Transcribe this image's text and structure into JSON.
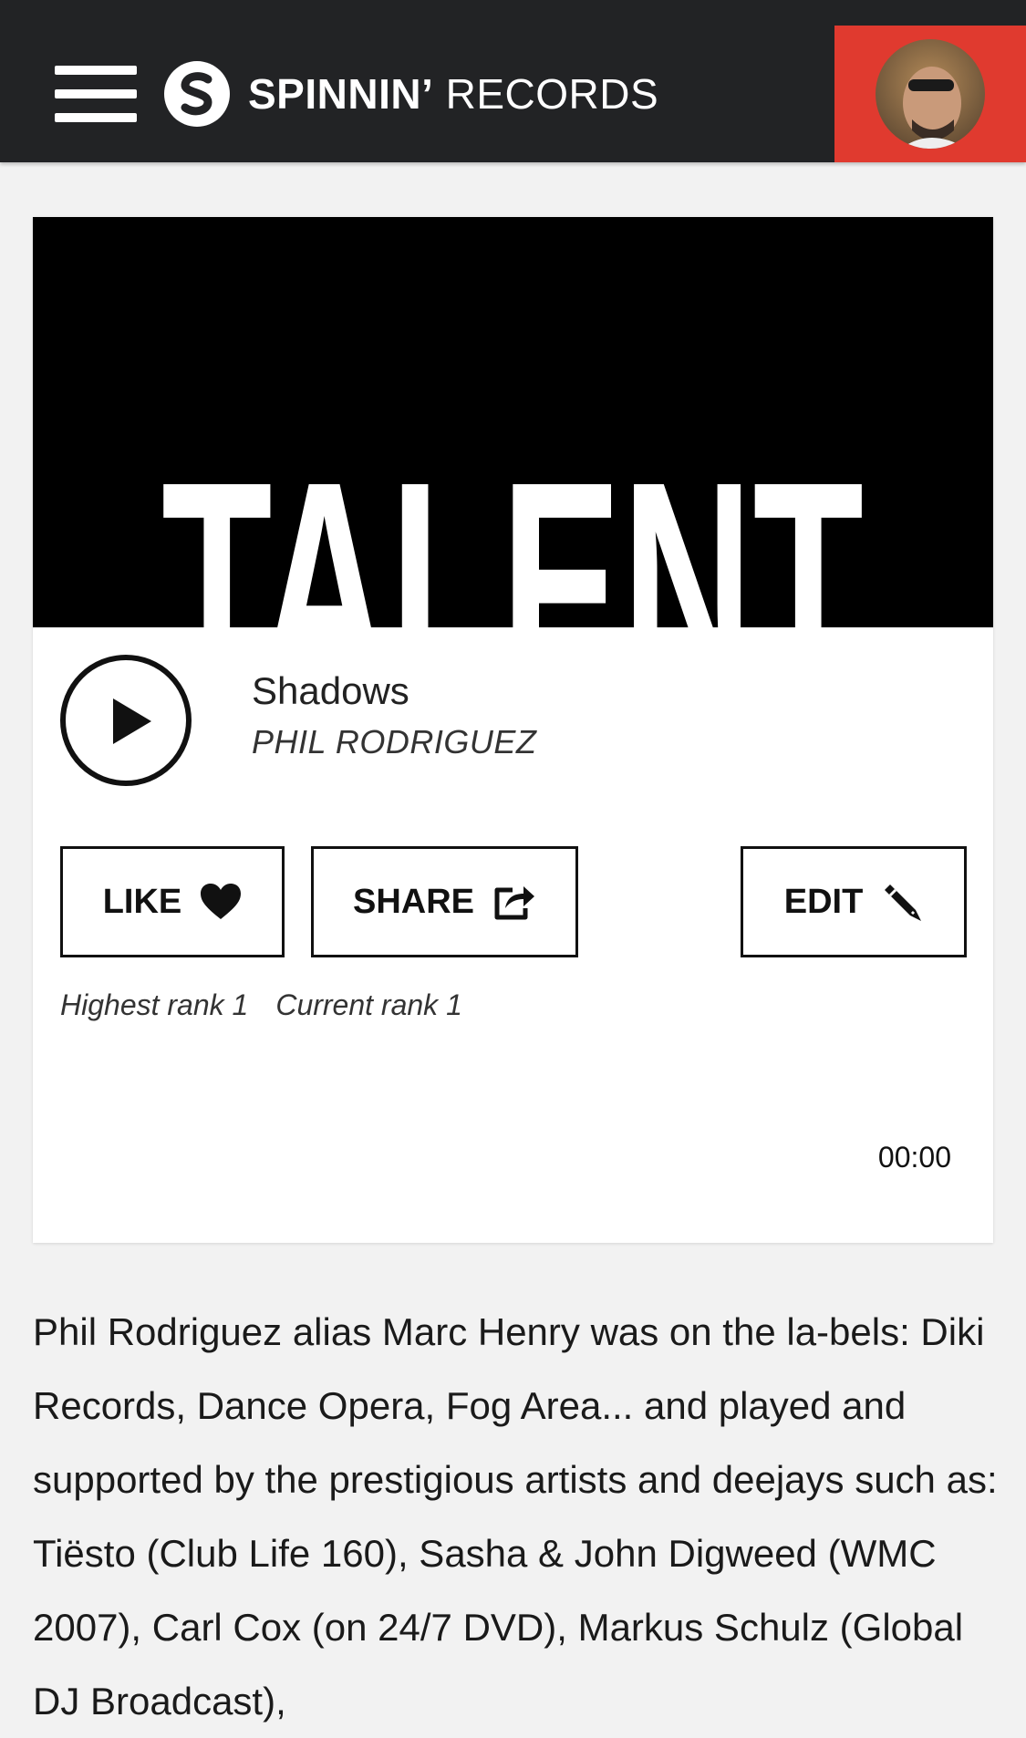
{
  "header": {
    "logo_bold": "SPINNIN’",
    "logo_light": " RECORDS",
    "accent_color": "#e03a2f",
    "menu_icon": "hamburger-menu-icon",
    "avatar": "user-avatar"
  },
  "track": {
    "cover_text": "TALENT",
    "title": "Shadows",
    "artist": "PHIL RODRIGUEZ",
    "time": "00:00"
  },
  "actions": {
    "like_label": "LIKE",
    "like_icon": "heart-icon",
    "share_label": "SHARE",
    "share_icon": "share-icon",
    "edit_label": "EDIT",
    "edit_icon": "pencil-icon"
  },
  "ranks": {
    "highest": "Highest rank 1",
    "current": "Current rank 1"
  },
  "description": "Phil Rodriguez alias Marc Henry was on the la-bels: Diki Records, Dance Opera, Fog Area... and played and supported by the prestigious artists and deejays such as: Tiësto (Club Life 160), Sasha & John Digweed (WMC 2007), Carl Cox (on 24/7 DVD), Markus Schulz (Global DJ Broadcast),"
}
